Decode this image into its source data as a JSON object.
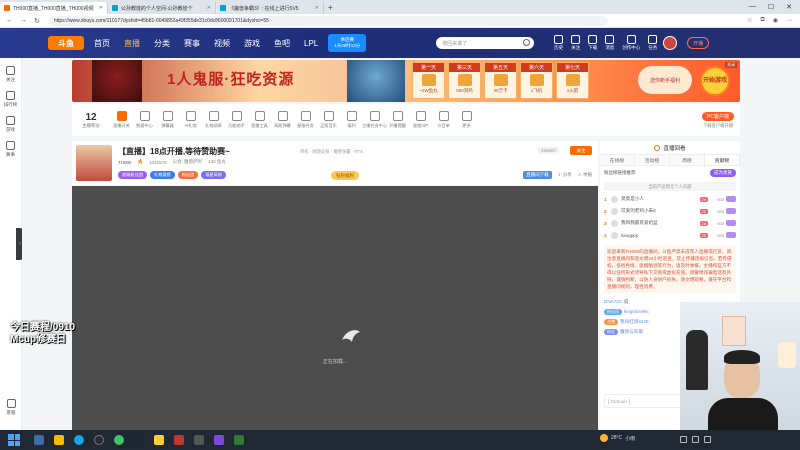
{
  "browser": {
    "tabs": [
      {
        "label": "TH000直播_TH000直播_TH000视频"
      },
      {
        "label": "公孙教徒的个人空间-公孙教徒个"
      },
      {
        "label": "《魔兽争霸3》: 在线上进行5V5"
      }
    ],
    "url": "https://www.douyu.com/110177dyshid=45b81-0049852a49f355de31c0dc8600091701&dyshci=55"
  },
  "header": {
    "logo": "斗鱼",
    "menu": [
      {
        "label": "首页"
      },
      {
        "label": "直播"
      },
      {
        "label": "分类"
      },
      {
        "label": "赛事"
      },
      {
        "label": "视频"
      },
      {
        "label": "游戏"
      },
      {
        "label": "鱼吧"
      },
      {
        "label": "LPL"
      }
    ],
    "match_badge_line1": "季后赛",
    "match_badge_line2": "1天08时13分",
    "search_placeholder": "搜回来谁了",
    "tools": [
      {
        "label": "历史"
      },
      {
        "label": "关注"
      },
      {
        "label": "下载"
      },
      {
        "label": "消息"
      },
      {
        "label": "创作中心"
      },
      {
        "label": "任务"
      }
    ],
    "open_live": "开播"
  },
  "left_sidebar": {
    "items": [
      {
        "label": "关注"
      },
      {
        "label": "排行榜"
      },
      {
        "label": "游戏"
      },
      {
        "label": "赛事"
      }
    ],
    "bottom_label": "客服"
  },
  "banner": {
    "title": "1人鬼服·狂吃资源",
    "days": [
      {
        "day": "第一天",
        "reward": "~2W鱼丸"
      },
      {
        "day": "第三天",
        "reward": "500洞鸡"
      },
      {
        "day": "第五天",
        "reward": "30万卡"
      },
      {
        "day": "第六天",
        "reward": "1飞机"
      },
      {
        "day": "第七天",
        "reward": "1火箭"
      }
    ],
    "cta": "送你新手福利",
    "open_button": "开始游戏",
    "close": "关闭"
  },
  "toolbar": {
    "rank_value": "12",
    "rank_label": "主播积分",
    "items": [
      {
        "label": "直播开关"
      },
      {
        "label": "数据中心"
      },
      {
        "label": "弹幕器"
      },
      {
        "label": "AI礼物"
      },
      {
        "label": "礼物勋章"
      },
      {
        "label": "万能助手"
      },
      {
        "label": "直播工具"
      },
      {
        "label": "高能弹幕"
      },
      {
        "label": "星推任务"
      },
      {
        "label": "正版音乐"
      },
      {
        "label": "福利"
      },
      {
        "label": "主播任务中心"
      },
      {
        "label": "开播提醒"
      },
      {
        "label": "星推VIP"
      },
      {
        "label": "节目单"
      },
      {
        "label": "更多"
      }
    ],
    "pc_button": "PC客户端",
    "pc_sub": "下载客户端开播"
  },
  "room": {
    "title": "【直播】18点开播,等待赞助赛~",
    "breadcrumb": "单机 · 网游竞技 · 魔兽争霸 · RTS",
    "anchor_name": "TH000",
    "hot": "1042578",
    "tag_public": "公会: 魔兽萨利",
    "followers": "430 鱼丸",
    "tags": [
      {
        "label": "超级粉丝团"
      },
      {
        "label": "礼物展馆"
      },
      {
        "label": "粉丝团"
      },
      {
        "label": "福星高照"
      }
    ],
    "gift_pill": "钻粉福利",
    "view_count": "456607",
    "follow": "关注",
    "share_badge": "直播间下载",
    "share": "分享",
    "report": "举报"
  },
  "player": {
    "loading_text": "正在加载..."
  },
  "right_panel": {
    "header": "直播回看",
    "tabs": [
      {
        "label": "在线榜"
      },
      {
        "label": "活动榜"
      },
      {
        "label": "周榜"
      },
      {
        "label": "贡献榜"
      }
    ],
    "rank_title": "粉丝榜链接推荐",
    "rank_chip": "成为贵族",
    "invite": "当前产品暂无个人贡献",
    "rows": [
      {
        "n": "1",
        "name": "莫莫是小人",
        "lv": "29",
        "val": "000"
      },
      {
        "n": "2",
        "name": "可爱的老鸡小朱6",
        "lv": "28",
        "val": "000"
      },
      {
        "n": "3",
        "name": "我和我最有爱奶盆",
        "lv": "28",
        "val": "000"
      },
      {
        "n": "4",
        "name": "liangppp",
        "lv": "28",
        "val": "000"
      }
    ],
    "notice": "欢迎来到TH000的直播间。斗鱼严禁未成年人直播或打赏。请注意直播间和谐文明24小时巡查，禁止传播违规信息。若有侵权、低俗色情、吸烟酗酒等行为，请及时举报。主播和官方不得以任何形式诱导私下交易或虚拟充值。请警惕诈骗电话及外链，谨慎判断，以防人身财产损失。请文明观看，遵守平台和直播间规则，理性消费。",
    "chats": [
      {
        "fan": "",
        "fan_color": "",
        "name": "DNA731:",
        "text": "说"
      },
      {
        "fan": "粉丝团",
        "fan_color": "blue",
        "name": "kingsfore95:",
        "text": ""
      },
      {
        "fan": "主播",
        "fan_color": "orange",
        "name": "我叫红烧6425:",
        "text": ""
      },
      {
        "fan": "粉丝",
        "fan_color": "",
        "name": "魔兽与风暴:",
        "text": ""
      }
    ],
    "input_placeholder": "[ OcSoul+ ]"
  },
  "overlay": {
    "line1": "今日赛程/0910",
    "line2": "Mcup修赛日"
  },
  "taskbar": {
    "weather_temp": "28°C",
    "weather_desc": "小雨"
  }
}
